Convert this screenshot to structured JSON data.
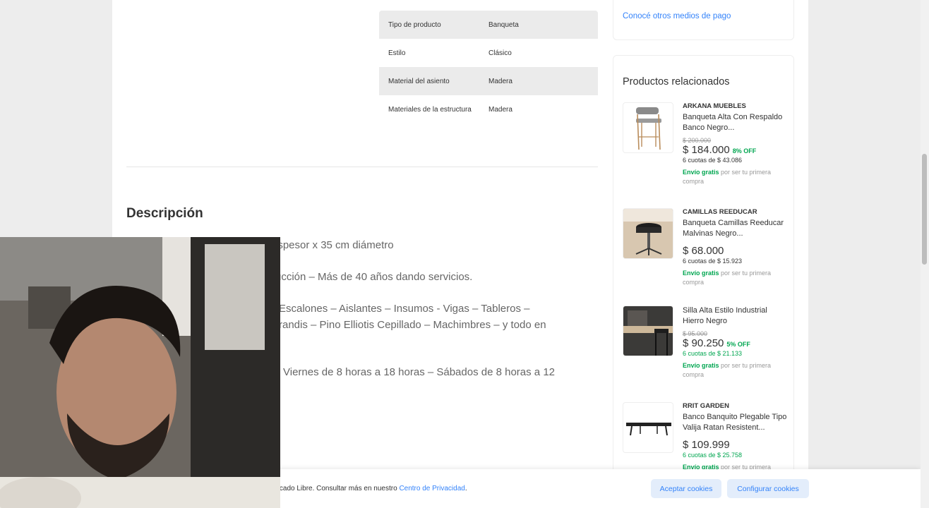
{
  "specs": [
    {
      "key": "Tipo de producto",
      "value": "Banqueta"
    },
    {
      "key": "Estilo",
      "value": "Clásico"
    },
    {
      "key": "Material del asiento",
      "value": "Madera"
    },
    {
      "key": "Materiales de la estructura",
      "value": "Madera"
    }
  ],
  "description": {
    "title": "Descripción",
    "lines": [
      "espesor x 35 cm diámetro",
      "rucción – Más de 40 años dando servicios.",
      "Escalones – Aislantes – Insumos - Vigas – Tableros –",
      "randis – Pino Elliotis Cepillado – Machimbres – y todo en",
      "Viernes de 8 horas a 18 horas – Sábados de 8 horas a 12"
    ]
  },
  "payment": {
    "link": "Conocé otros medios de pago"
  },
  "related": {
    "title": "Productos relacionados",
    "products": [
      {
        "brand": "ARKANA MUEBLES",
        "name": "Banqueta Alta Con Respaldo Banco Negro...",
        "old_price": "$ 200.000",
        "price": "$ 184.000",
        "off": "8% OFF",
        "cuotas": "6 cuotas de $ 43.086",
        "envio_green": "Envío gratis",
        "envio_rest": "por ser tu primera compra",
        "thumb_icon": "bar-stool-image"
      },
      {
        "brand": "CAMILLAS REEDUCAR",
        "name": "Banqueta Camillas Reeducar Malvinas Negro...",
        "old_price": "",
        "price": "$ 68.000",
        "off": "",
        "cuotas": "6 cuotas de $ 15.923",
        "envio_green": "Envío gratis",
        "envio_rest": "por ser tu primera compra",
        "thumb_icon": "round-stool-image"
      },
      {
        "brand": "",
        "name": "Silla Alta Estilo Industrial Hierro Negro",
        "old_price": "$ 95.000",
        "price": "$ 90.250",
        "off": "5% OFF",
        "cuotas": "6 cuotas de $ 21.133",
        "envio_green": "Envío gratis",
        "envio_rest": "por ser tu primera compra",
        "thumb_icon": "industrial-chair-image"
      },
      {
        "brand": "RRIT GARDEN",
        "name": "Banco Banquito Plegable Tipo Valija Ratan Resistent...",
        "old_price": "",
        "price": "$ 109.999",
        "off": "",
        "cuotas": "6 cuotas de $ 25.758",
        "envio_green": "Envío gratis",
        "envio_rest": "por ser tu primera",
        "thumb_icon": "folding-bench-image"
      }
    ]
  },
  "cookie": {
    "text_prefix": "ercado Libre. Consultar más en nuestro ",
    "link": "Centro de Privacidad",
    "text_suffix": ".",
    "accept": "Aceptar cookies",
    "configure": "Configurar cookies"
  },
  "colors": {
    "accent": "#3483fa",
    "green": "#00a650"
  }
}
